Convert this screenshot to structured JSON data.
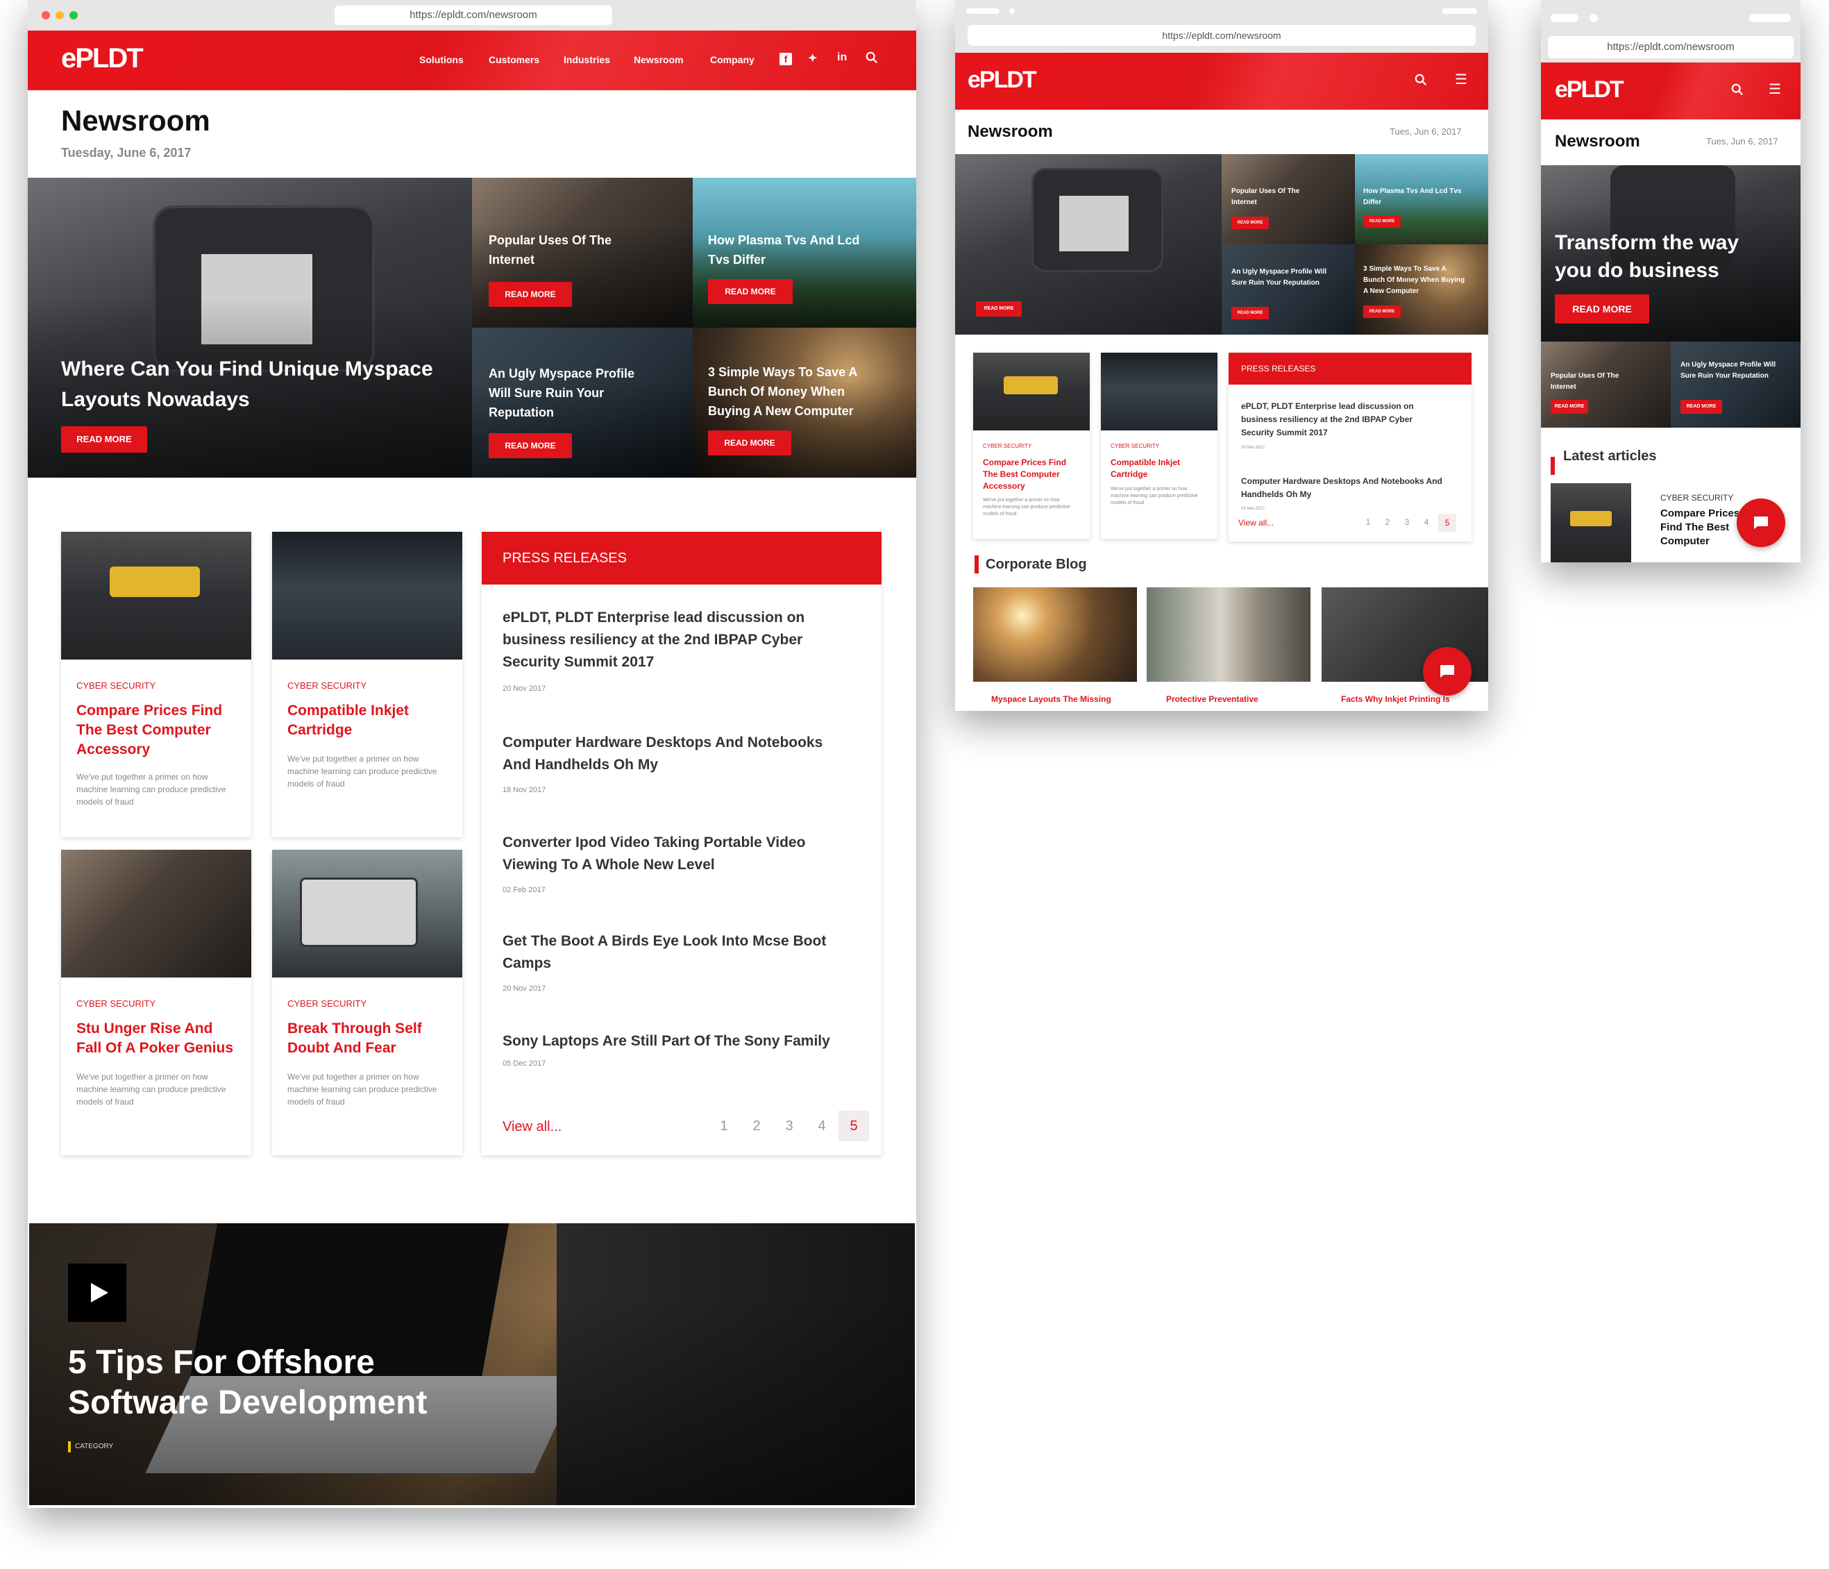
{
  "browser": {
    "url": "https://epldt.com/newsroom"
  },
  "brand": {
    "logo": "ePLDT",
    "accent": "#e0141b"
  },
  "desktop": {
    "nav": [
      "Solutions",
      "Customers",
      "Industries",
      "Newsroom",
      "Company"
    ],
    "social_icons": [
      "facebook-icon",
      "twitter-icon",
      "linkedin-icon",
      "search-icon"
    ],
    "title": "Newsroom",
    "date": "Tuesday, June 6, 2017",
    "hero": {
      "title": "Where Can You Find Unique Myspace Layouts Nowadays",
      "button": "READ MORE"
    },
    "tiles": [
      {
        "title": "Popular Uses Of The Internet",
        "button": "READ MORE"
      },
      {
        "title": "How Plasma Tvs And Lcd Tvs Differ",
        "button": "READ MORE"
      },
      {
        "title": "An Ugly Myspace Profile Will Sure Ruin Your Reputation",
        "button": "READ MORE"
      },
      {
        "title": "3 Simple Ways To Save A Bunch Of Money When Buying A New Computer",
        "button": "READ MORE"
      }
    ],
    "cards": [
      {
        "category": "CYBER SECURITY",
        "title": "Compare Prices Find The Best Computer Accessory",
        "desc": "We've put together a primer on how machine learning can produce predictive models of fraud"
      },
      {
        "category": "CYBER SECURITY",
        "title": "Compatible Inkjet Cartridge",
        "desc": "We've put together a primer on how machine learning can produce predictive models of fraud"
      },
      {
        "category": "CYBER SECURITY",
        "title": "Stu Unger Rise And Fall Of A Poker Genius",
        "desc": "We've put together a primer on how machine learning can produce predictive models of fraud"
      },
      {
        "category": "CYBER SECURITY",
        "title": "Break Through Self Doubt And Fear",
        "desc": "We've put together a primer on how machine learning can produce predictive models of fraud"
      }
    ],
    "press": {
      "header": "PRESS RELEASES",
      "items": [
        {
          "title": "ePLDT, PLDT Enterprise lead discussion on business resiliency at the 2nd IBPAP Cyber Security Summit 2017",
          "date": "20 Nov 2017"
        },
        {
          "title": "Computer Hardware Desktops And Notebooks And Handhelds Oh My",
          "date": "18 Nov 2017"
        },
        {
          "title": "Converter Ipod Video Taking Portable Video Viewing To A Whole New Level",
          "date": "02 Feb 2017"
        },
        {
          "title": "Get The Boot A Birds Eye Look Into Mcse Boot Camps",
          "date": "20 Nov 2017"
        },
        {
          "title": "Sony Laptops Are Still Part Of The Sony Family",
          "date": "05 Dec 2017"
        }
      ],
      "view_all": "View all...",
      "pages": [
        "1",
        "2",
        "3",
        "4",
        "5"
      ],
      "current_page": "5"
    },
    "video": {
      "title": "5 Tips For Offshore Software Development",
      "category": "CATEGORY"
    }
  },
  "tablet": {
    "title": "Newsroom",
    "date": "Tues, Jun 6, 2017",
    "hero_button": "READ MORE",
    "tiles": [
      {
        "title": "Popular Uses Of The Internet",
        "button": "READ MORE"
      },
      {
        "title": "How Plasma Tvs And Lcd Tvs Differ",
        "button": "READ MORE"
      },
      {
        "title": "An Ugly Myspace Profile Will Sure Ruin Your Reputation",
        "button": "READ MORE"
      },
      {
        "title": "3 Simple Ways To Save A Bunch Of Money When Buying A New Computer",
        "button": "READ MORE"
      }
    ],
    "cards": [
      {
        "category": "CYBER SECURITY",
        "title": "Compare Prices Find The Best Computer Accessory",
        "desc": "We've put together a primer on how machine learning can produce predictive models of fraud"
      },
      {
        "category": "CYBER SECURITY",
        "title": "Compatible Inkjet Cartridge",
        "desc": "We've put together a primer on how machine learning can produce predictive models of fraud"
      }
    ],
    "press": {
      "header": "PRESS RELEASES",
      "items": [
        {
          "title": "ePLDT, PLDT Enterprise lead discussion on business resiliency at the 2nd IBPAP Cyber Security Summit 2017",
          "date": "20 Nov 2017"
        },
        {
          "title": "Computer Hardware Desktops And Notebooks And Handhelds Oh My",
          "date": "18 Nov 2017"
        }
      ],
      "view_all": "View all...",
      "pages": [
        "1",
        "2",
        "3",
        "4",
        "5"
      ],
      "current_page": "5"
    },
    "blog_title": "Corporate Blog",
    "blog": [
      "Myspace Layouts The Missing",
      "Protective Preventative",
      "Facts Why Inkjet Printing Is"
    ]
  },
  "mobile": {
    "title": "Newsroom",
    "date": "Tues, Jun 6, 2017",
    "hero": {
      "title": "Transform the way you do business",
      "button": "READ MORE"
    },
    "tiles": [
      {
        "title": "Popular Uses Of The Internet",
        "button": "READ MORE"
      },
      {
        "title": "An Ugly Myspace Profile Will Sure Ruin Your Reputation",
        "button": "READ MORE"
      }
    ],
    "latest": "Latest articles",
    "article": {
      "category": "CYBER SECURITY",
      "title": "Compare Prices Find The Best Computer Accessory"
    }
  }
}
